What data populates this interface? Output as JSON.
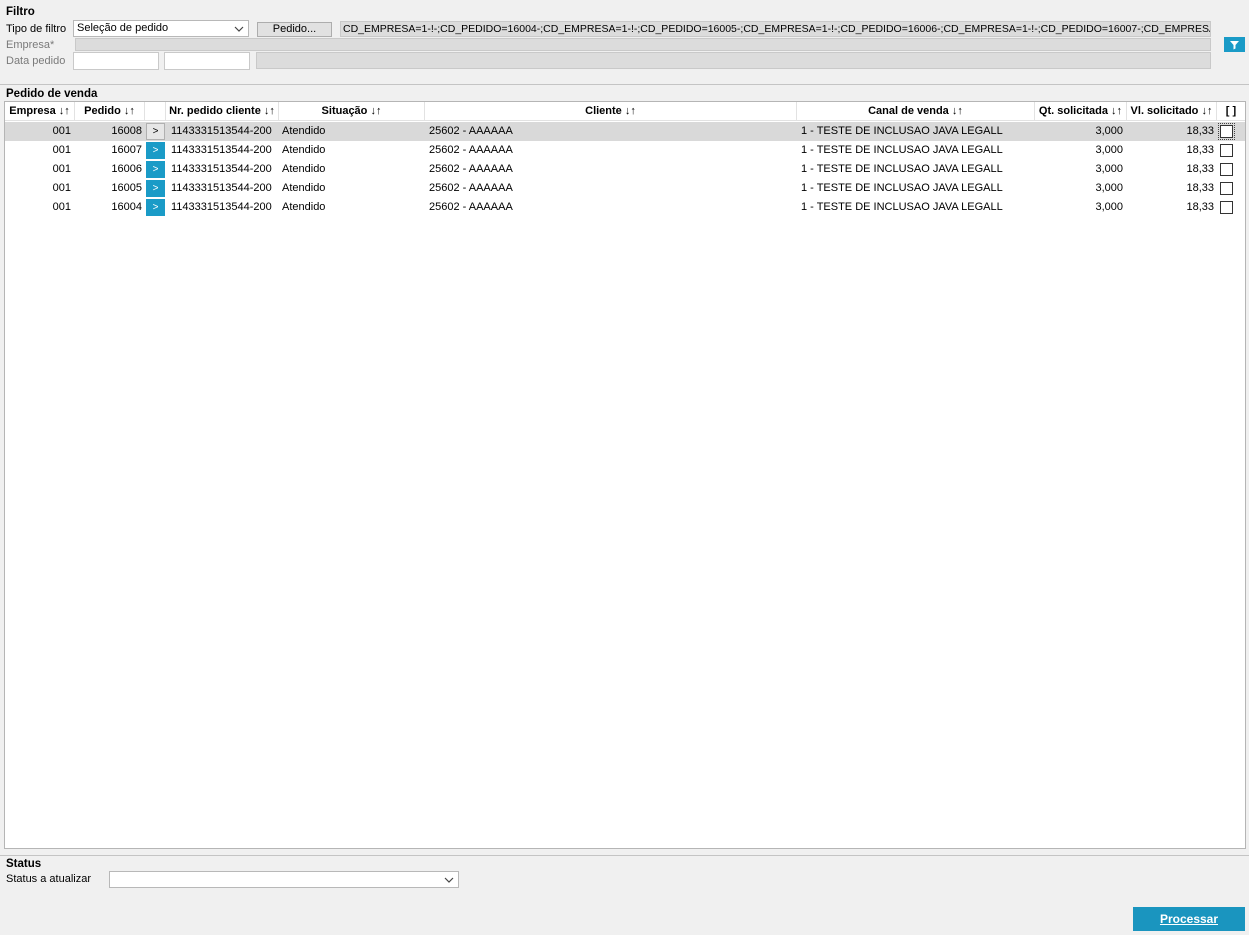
{
  "filtro": {
    "title": "Filtro",
    "tipo_label": "Tipo de filtro",
    "tipo_value": "Seleção de pedido",
    "pedido_button": "Pedido...",
    "pedido_selection": "CD_EMPRESA=1-!-;CD_PEDIDO=16004-;CD_EMPRESA=1-!-;CD_PEDIDO=16005-;CD_EMPRESA=1-!-;CD_PEDIDO=16006-;CD_EMPRESA=1-!-;CD_PEDIDO=16007-;CD_EMPRESA=1-!-;C",
    "empresa_label": "Empresa*",
    "data_label": "Data pedido",
    "filter_icon": "filter-icon"
  },
  "pedidos": {
    "title": "Pedido de venda",
    "columns": {
      "empresa": "Empresa ↓↑",
      "pedido": "Pedido ↓↑",
      "nr_cliente": "Nr. pedido cliente ↓↑",
      "situacao": "Situação ↓↑",
      "cliente": "Cliente ↓↑",
      "canal": "Canal de venda ↓↑",
      "qt": "Qt. solicitada ↓↑",
      "vl": "Vl. solicitado ↓↑",
      "sel": "[ ]"
    },
    "rows": [
      {
        "empresa": "001",
        "pedido": "16008",
        "go": ">",
        "nr_cliente": "1143331513544-200",
        "situacao": "Atendido",
        "cliente": "25602 - AAAAAA",
        "canal": "1 - TESTE DE INCLUSAO JAVA LEGALL",
        "qt": "3,000",
        "vl": "18,33"
      },
      {
        "empresa": "001",
        "pedido": "16007",
        "go": ">",
        "nr_cliente": "1143331513544-200",
        "situacao": "Atendido",
        "cliente": "25602 - AAAAAA",
        "canal": "1 - TESTE DE INCLUSAO JAVA LEGALL",
        "qt": "3,000",
        "vl": "18,33"
      },
      {
        "empresa": "001",
        "pedido": "16006",
        "go": ">",
        "nr_cliente": "1143331513544-200",
        "situacao": "Atendido",
        "cliente": "25602 - AAAAAA",
        "canal": "1 - TESTE DE INCLUSAO JAVA LEGALL",
        "qt": "3,000",
        "vl": "18,33"
      },
      {
        "empresa": "001",
        "pedido": "16005",
        "go": ">",
        "nr_cliente": "1143331513544-200",
        "situacao": "Atendido",
        "cliente": "25602 - AAAAAA",
        "canal": "1 - TESTE DE INCLUSAO JAVA LEGALL",
        "qt": "3,000",
        "vl": "18,33"
      },
      {
        "empresa": "001",
        "pedido": "16004",
        "go": ">",
        "nr_cliente": "1143331513544-200",
        "situacao": "Atendido",
        "cliente": "25602 - AAAAAA",
        "canal": "1 - TESTE DE INCLUSAO JAVA LEGALL",
        "qt": "3,000",
        "vl": "18,33"
      }
    ]
  },
  "status": {
    "title": "Status",
    "label": "Status a atualizar",
    "value": ""
  },
  "actions": {
    "processar": "Processar"
  },
  "colors": {
    "accent": "#1a9bc7",
    "selected_row": "#d9d9d9",
    "background": "#f0f0f0"
  }
}
